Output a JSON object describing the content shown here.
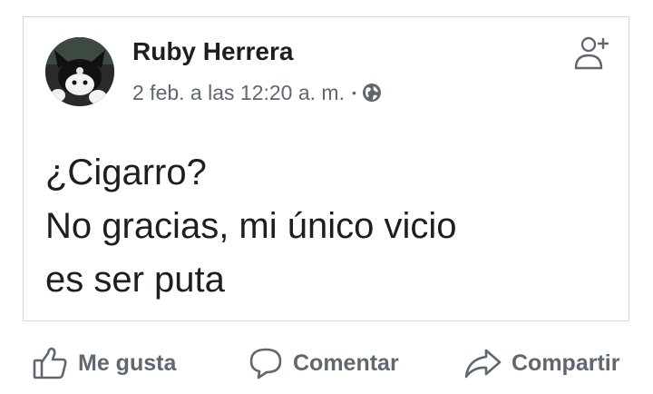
{
  "post": {
    "author_name": "Ruby Herrera",
    "timestamp": "2 feb. a las 12:20 a. m.",
    "separator": "•",
    "privacy_icon": "globe-icon",
    "add_friend_icon": "add-friend-icon",
    "text_lines": [
      "¿Cigarro?",
      "No gracias, mi único vicio",
      "es ser puta"
    ]
  },
  "actions": {
    "like_label": "Me gusta",
    "comment_label": "Comentar",
    "share_label": "Compartir",
    "like_icon": "thumbs-up-icon",
    "comment_icon": "speech-bubble-icon",
    "share_icon": "share-arrow-icon"
  },
  "colors": {
    "text_primary": "#1c1e21",
    "text_secondary": "#606770",
    "card_border": "#d6d8dc",
    "background": "#ffffff"
  }
}
